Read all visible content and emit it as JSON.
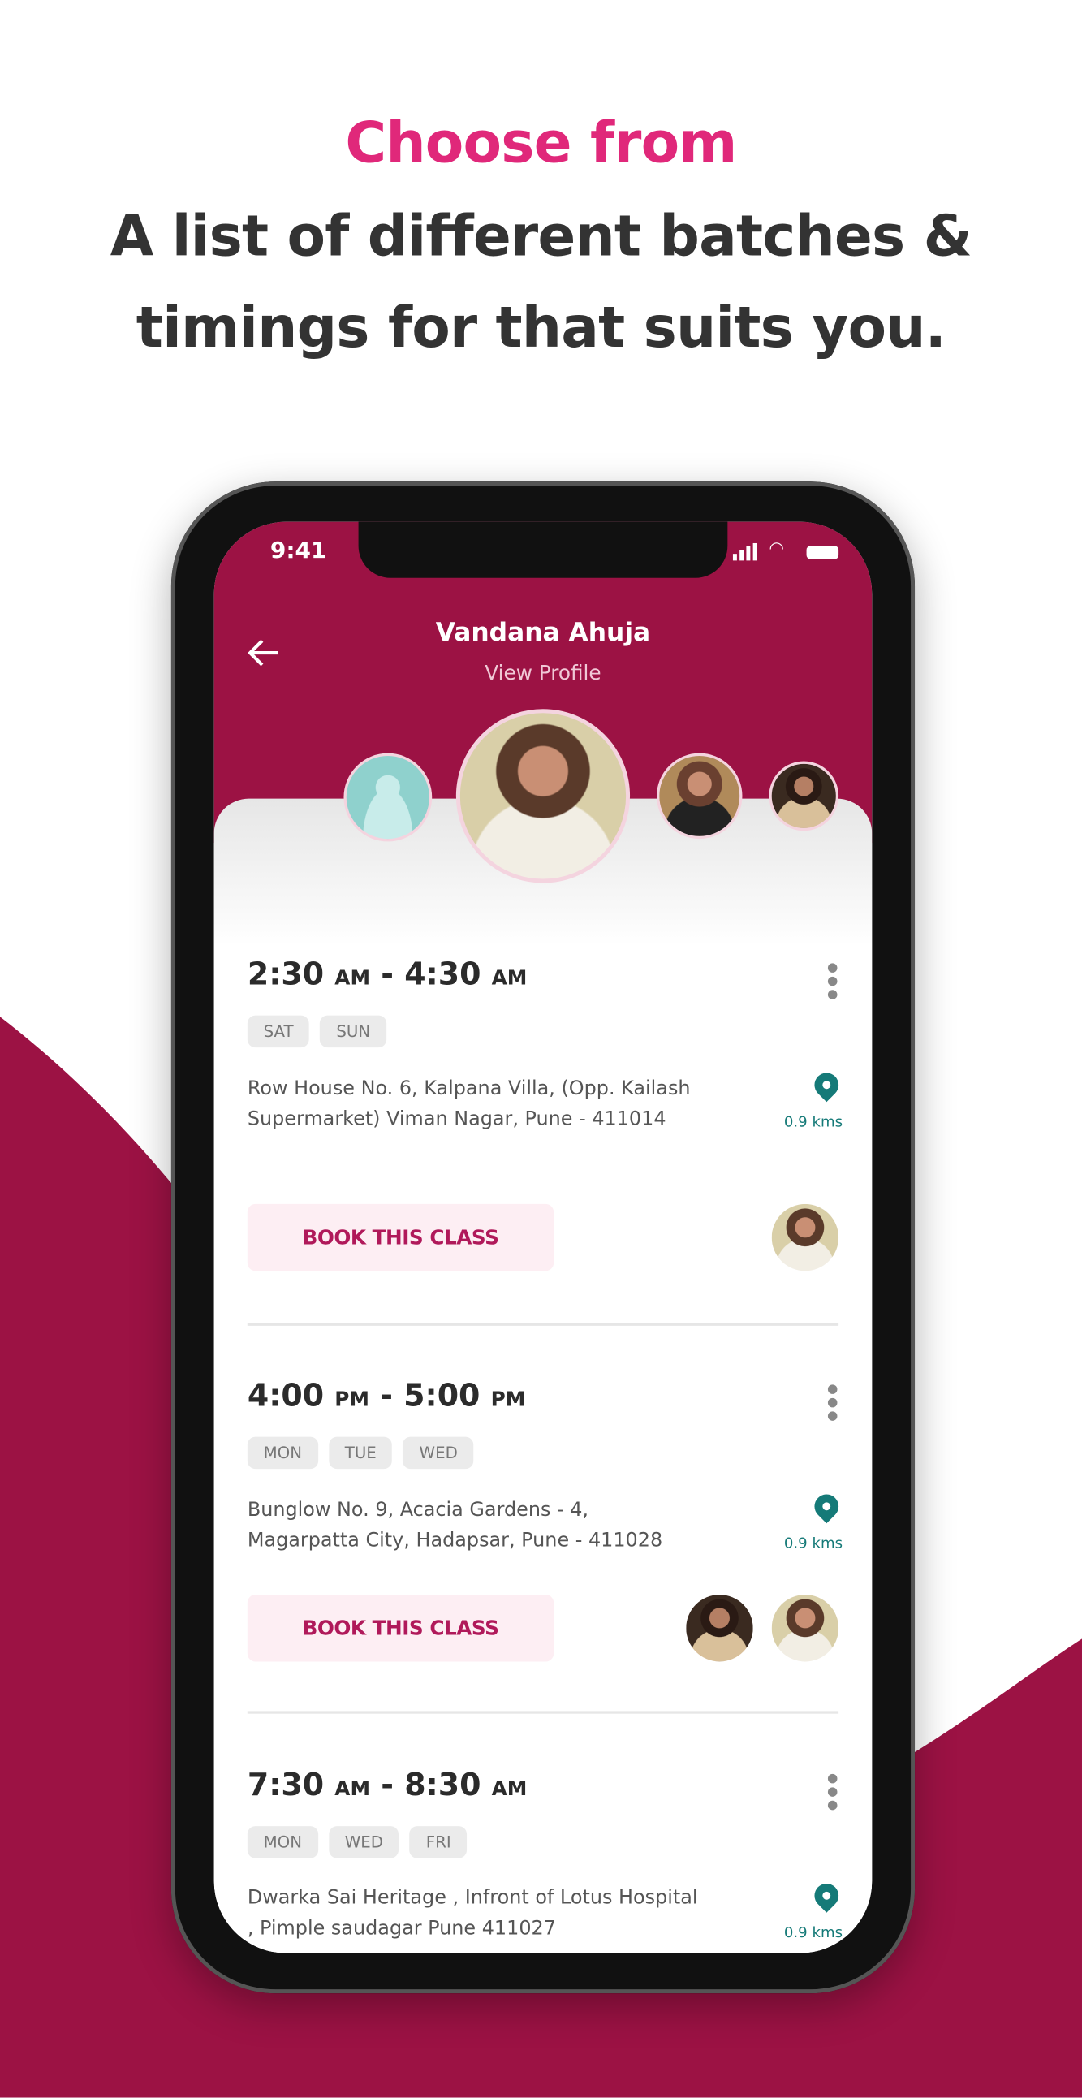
{
  "marketing": {
    "line1": "Choose from",
    "line2": "A list of different batches &",
    "line3": "timings for  that suits you.",
    "accent": "#e0287a",
    "bg_accent": "#9c1244"
  },
  "status_bar": {
    "time": "9:41"
  },
  "header": {
    "title": "Vandana Ahuja",
    "subtitle": "View Profile",
    "back_icon": "arrow-left-icon"
  },
  "batches": [
    {
      "start": "2:30",
      "start_suffix": "AM",
      "sep": "-",
      "end": "4:30",
      "end_suffix": "AM",
      "days": [
        "SAT",
        "SUN"
      ],
      "address": "Row House No. 6, Kalpana Villa, (Opp. Kailash Supermarket) Viman Nagar, Pune - 411014",
      "distance": "0.9 kms",
      "button": "BOOK THIS CLASS"
    },
    {
      "start": "4:00",
      "start_suffix": "PM",
      "sep": "-",
      "end": "5:00",
      "end_suffix": "PM",
      "days": [
        "MON",
        "TUE",
        "WED"
      ],
      "address": "Bunglow No. 9, Acacia Gardens - 4, Magarpatta City, Hadapsar, Pune - 411028",
      "distance": "0.9 kms",
      "button": "BOOK THIS CLASS"
    },
    {
      "start": "7:30",
      "start_suffix": "AM",
      "sep": "-",
      "end": "8:30",
      "end_suffix": "AM",
      "days": [
        "MON",
        "WED",
        "FRI"
      ],
      "address": "Dwarka Sai Heritage , Infront of Lotus Hospital , Pimple saudagar Pune 411027",
      "distance": "0.9 kms"
    }
  ]
}
